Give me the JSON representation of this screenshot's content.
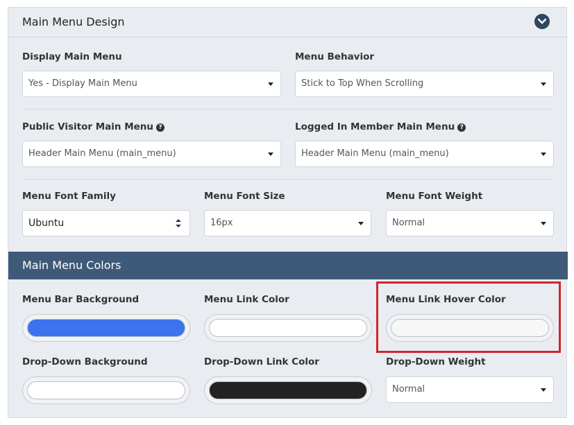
{
  "section": {
    "title": "Main Menu Design"
  },
  "fields": {
    "display_main_menu": {
      "label": "Display Main Menu",
      "value": "Yes - Display Main Menu"
    },
    "menu_behavior": {
      "label": "Menu Behavior",
      "value": "Stick to Top When Scrolling"
    },
    "public_visitor_menu": {
      "label": "Public Visitor Main Menu",
      "value": "Header Main Menu (main_menu)"
    },
    "logged_in_menu": {
      "label": "Logged In Member Main Menu",
      "value": "Header Main Menu (main_menu)"
    },
    "font_family": {
      "label": "Menu Font Family",
      "value": "Ubuntu"
    },
    "font_size": {
      "label": "Menu Font Size",
      "value": "16px"
    },
    "font_weight": {
      "label": "Menu Font Weight",
      "value": "Normal"
    }
  },
  "colors_section": {
    "title": "Main Menu Colors"
  },
  "colors": {
    "menu_bar_bg": {
      "label": "Menu Bar Background",
      "color": "#3b72ee"
    },
    "menu_link": {
      "label": "Menu Link Color",
      "color": "#ffffff"
    },
    "menu_link_hover": {
      "label": "Menu Link Hover Color",
      "color": "#f7f7f7"
    },
    "dropdown_bg": {
      "label": "Drop-Down Background",
      "color": "#ffffff"
    },
    "dropdown_link": {
      "label": "Drop-Down Link Color",
      "color": "#222222"
    }
  },
  "dropdown_weight": {
    "label": "Drop-Down Weight",
    "value": "Normal"
  }
}
